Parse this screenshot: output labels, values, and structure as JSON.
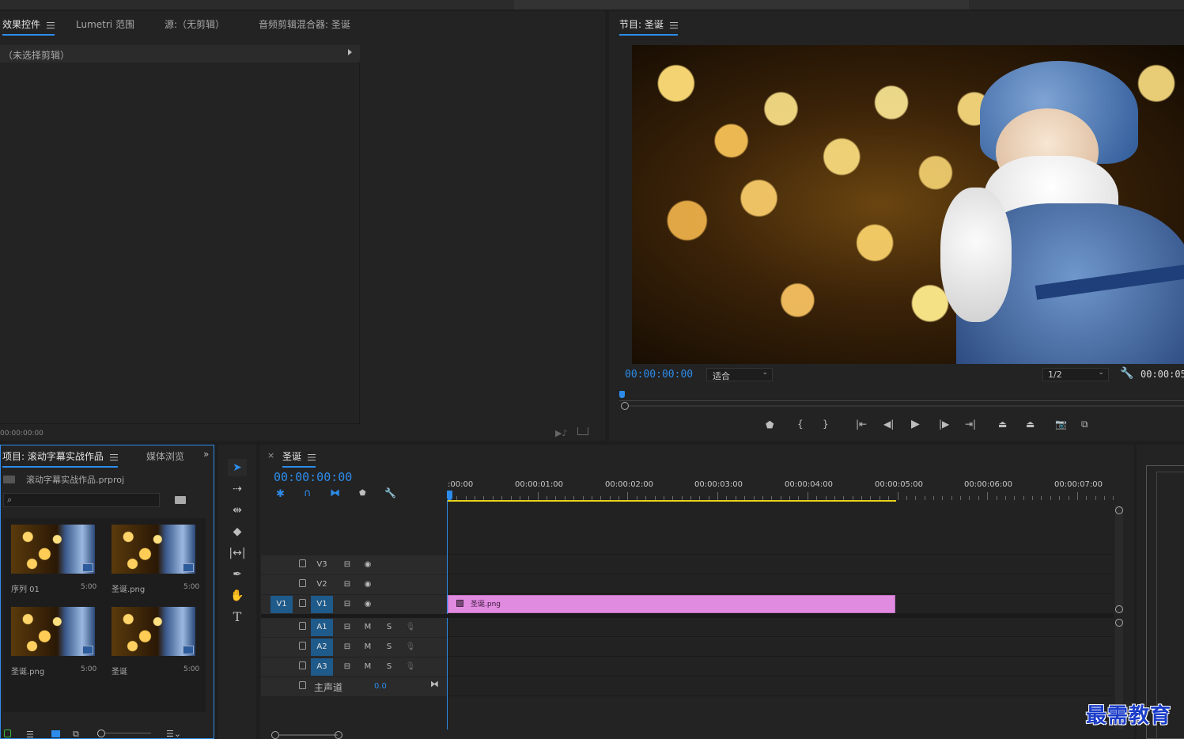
{
  "effects_panel": {
    "tabs": [
      "效果控件",
      "Lumetri 范围",
      "源:（无剪辑）",
      "音频剪辑混合器: 圣诞"
    ],
    "no_clip": "（未选择剪辑）",
    "timecode": "00:00:00:00"
  },
  "program_monitor": {
    "title": "节目: 圣诞",
    "timecode_left": "00:00:00:00",
    "fit": "适合",
    "resolution": "1/2",
    "timecode_right": "00:00:05"
  },
  "project_panel": {
    "title": "项目: 滚动字幕实战作品",
    "tab2": "媒体浏览",
    "file": "滚动字幕实战作品.prproj",
    "items": [
      {
        "name": "序列 01",
        "duration": "5:00"
      },
      {
        "name": "圣诞.png",
        "duration": "5:00"
      },
      {
        "name": "圣诞.png",
        "duration": "5:00"
      },
      {
        "name": "圣诞",
        "duration": "5:00"
      }
    ]
  },
  "timeline": {
    "title": "圣诞",
    "close": "×",
    "timecode": "00:00:00:00",
    "ruler": [
      ":00:00",
      "00:00:01:00",
      "00:00:02:00",
      "00:00:03:00",
      "00:00:04:00",
      "00:00:05:00",
      "00:00:06:00",
      "00:00:07:00"
    ],
    "video_tracks": [
      "V3",
      "V2",
      "V1"
    ],
    "source_patch": "V1",
    "audio_tracks": [
      "A1",
      "A2",
      "A3"
    ],
    "mute": "M",
    "solo": "S",
    "master_label": "主声道",
    "master_value": "0.0",
    "clip_name": "圣诞.png"
  },
  "watermark": "最需教育",
  "colors": {
    "accent": "#2d8ceb",
    "clip": "#e08ae0",
    "work_area": "#e6d31a"
  }
}
